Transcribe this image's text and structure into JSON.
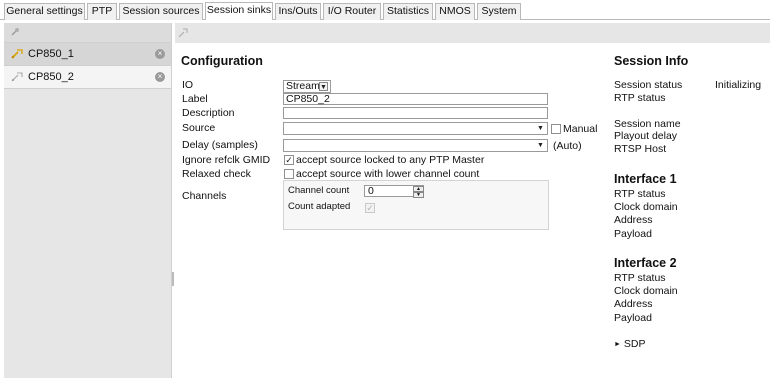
{
  "tabs": [
    {
      "label": "General settings",
      "active": false
    },
    {
      "label": "PTP",
      "active": false
    },
    {
      "label": "Session sources",
      "active": false
    },
    {
      "label": "Session sinks",
      "active": true
    },
    {
      "label": "Ins/Outs",
      "active": false
    },
    {
      "label": "I/O Router",
      "active": false
    },
    {
      "label": "Statistics",
      "active": false
    },
    {
      "label": "NMOS",
      "active": false
    },
    {
      "label": "System",
      "active": false
    }
  ],
  "sidebar": {
    "items": [
      {
        "label": "CP850_1",
        "selected": true
      },
      {
        "label": "CP850_2",
        "selected": false
      }
    ]
  },
  "config": {
    "title": "Configuration",
    "io_label": "IO",
    "io_value": "Stream",
    "label_label": "Label",
    "label_value": "CP850_2",
    "description_label": "Description",
    "description_value": "",
    "source_label": "Source",
    "source_value": "",
    "manual_label": "Manual",
    "delay_label": "Delay (samples)",
    "delay_value": "",
    "delay_auto": "(Auto)",
    "ignore_label": "Ignore refclk GMID",
    "ignore_text": "accept source locked to any PTP Master",
    "ignore_checked": true,
    "relaxed_label": "Relaxed check",
    "relaxed_text": "accept source with lower channel count",
    "relaxed_checked": false,
    "channels_label": "Channels",
    "channel_count_label": "Channel count",
    "channel_count_value": "0",
    "count_adapted_label": "Count adapted",
    "count_adapted_checked": true
  },
  "session_info": {
    "title": "Session Info",
    "session_status_label": "Session status",
    "session_status_value": "Initializing",
    "rtp_status_label": "RTP status",
    "session_name_label": "Session name",
    "playout_delay_label": "Playout delay",
    "rtsp_host_label": "RTSP Host"
  },
  "interface1": {
    "title": "Interface 1",
    "rtp_status_label": "RTP status",
    "clock_domain_label": "Clock domain",
    "address_label": "Address",
    "payload_label": "Payload"
  },
  "interface2": {
    "title": "Interface 2",
    "rtp_status_label": "RTP status",
    "clock_domain_label": "Clock domain",
    "address_label": "Address",
    "payload_label": "Payload"
  },
  "sdp": {
    "toggle_icon": "triangle-right",
    "label": "SDP"
  },
  "colors": {
    "accent": "#d9a400"
  }
}
